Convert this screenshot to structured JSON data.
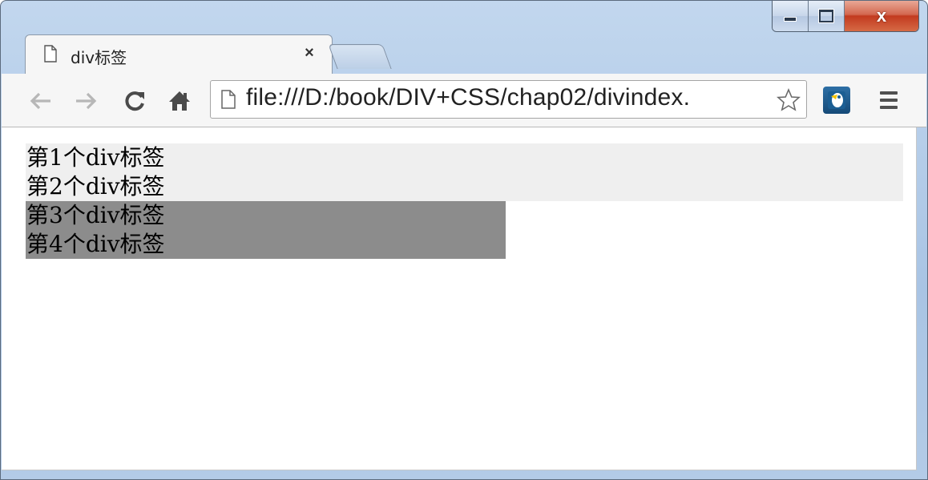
{
  "browser": {
    "tab": {
      "title": "div标签",
      "close_label": "×"
    },
    "address": {
      "url": "file:///D:/book/DIV+CSS/chap02/divindex."
    },
    "caption": {
      "minimize": "minimize-icon",
      "maximize": "maximize-icon",
      "close_label": "x"
    }
  },
  "icons": [
    "back-icon",
    "forward-icon",
    "reload-icon",
    "home-icon",
    "page-icon",
    "star-icon",
    "extension-icon",
    "menu-icon"
  ],
  "page": {
    "divs": [
      {
        "text": "第1个div标签",
        "style": "light"
      },
      {
        "text": "第2个div标签",
        "style": "light"
      },
      {
        "text": "第3个div标签",
        "style": "dark"
      },
      {
        "text": "第4个div标签",
        "style": "dark"
      }
    ]
  },
  "colors": {
    "light_bg": "#efefef",
    "dark_bg": "#8c8c8c"
  }
}
